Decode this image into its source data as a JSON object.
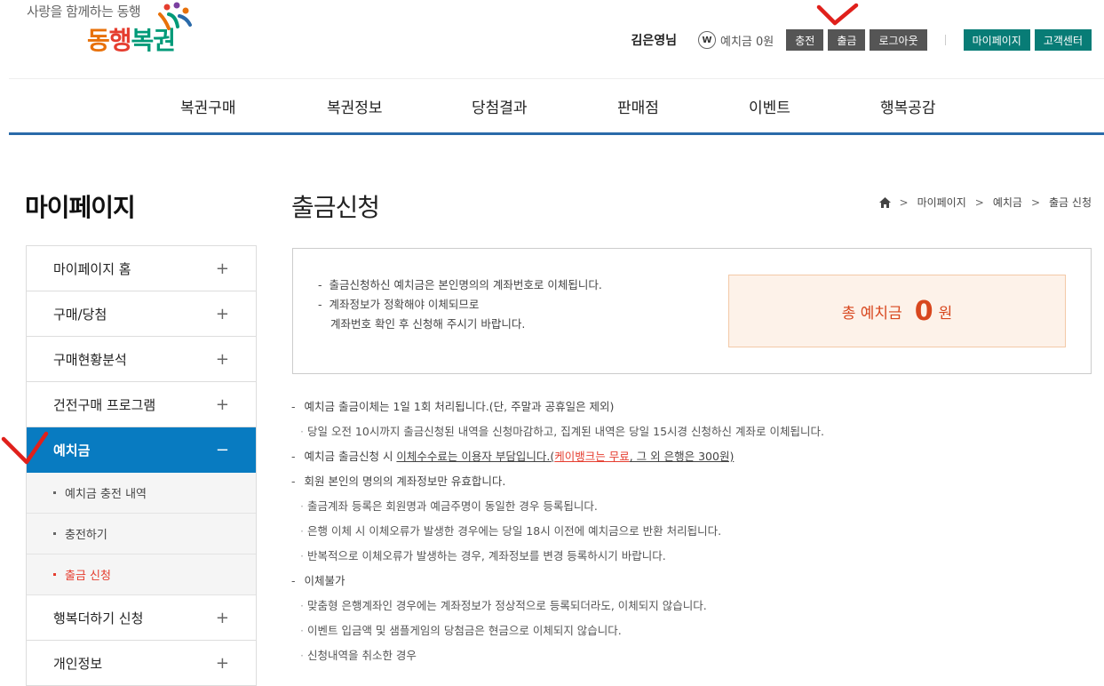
{
  "header": {
    "slogan": "사랑을 함께하는 동행",
    "brand_part1": "동",
    "brand_part2": "행",
    "brand_part3": "복권",
    "user_name": "김은영님",
    "w_badge": "W",
    "balance_text": "예치금 0원",
    "buttons": [
      "충전",
      "출금",
      "로그아웃"
    ],
    "right_buttons": [
      "마이페이지",
      "고객센터"
    ]
  },
  "gnb": [
    "복권구매",
    "복권정보",
    "당첨결과",
    "판매점",
    "이벤트",
    "행복공감"
  ],
  "sidebar": {
    "title": "마이페이지",
    "items": [
      {
        "label": "마이페이지 홈",
        "sign": "+"
      },
      {
        "label": "구매/당첨",
        "sign": "+"
      },
      {
        "label": "구매현황분석",
        "sign": "+"
      },
      {
        "label": "건전구매 프로그램",
        "sign": "+"
      },
      {
        "label": "예치금",
        "sign": "−"
      }
    ],
    "subitems": [
      "예치금 충전 내역",
      "충전하기",
      "출금 신청"
    ],
    "items_after": [
      {
        "label": "행복더하기 신청",
        "sign": "+"
      },
      {
        "label": "개인정보",
        "sign": "+"
      }
    ]
  },
  "main": {
    "title": "출금신청",
    "breadcrumb": [
      "마이페이지",
      "예치금",
      "출금 신청"
    ],
    "info": {
      "line1": "출금신청하신 예치금은 본인명의의 계좌번호로 이체됩니다.",
      "line2": "계좌정보가 정확해야 이체되므로",
      "line3": "계좌번호 확인 후 신청해 주시기 바랍니다."
    },
    "total": {
      "label": "총 예치금",
      "amount": "0",
      "unit": "원"
    },
    "notes": {
      "n1": "예치금 출금이체는 1일 1회 처리됩니다.(단, 주말과 공휴일은 제외)",
      "n1a": "당일 오전 10시까지 출금신청된 내역을 신청마감하고, 집계된 내역은 당일 15시경 신청하신 계좌로 이체됩니다.",
      "n2_pre": "예치금 출금신청 시 ",
      "n2_u": "이체수수료는 이용자 부담입니다.",
      "n2_paren_open": "(",
      "n2_red": "케이뱅크는 무료",
      "n2_rest": ", 그 외 은행은 300원)",
      "n3": "회원 본인의 명의의 계좌정보만 유효합니다.",
      "n3a": "출금계좌 등록은 회원명과 예금주명이 동일한 경우 등록됩니다.",
      "n3b": "은행 이체 시 이체오류가 발생한 경우에는 당일 18시 이전에 예치금으로 반환 처리됩니다.",
      "n3c": "반복적으로 이체오류가 발생하는 경우, 계좌정보를 변경 등록하시기 바랍니다.",
      "n4": "이체불가",
      "n4a": "맞춤형 은행계좌인 경우에는 계좌정보가 정상적으로 등록되더라도, 이체되지 않습니다.",
      "n4b": "이벤트 입금액 및 샘플게임의 당첨금은 현금으로 이체되지 않습니다.",
      "n4c": "신청내역을 취소한 경우"
    }
  },
  "colors": {
    "accent_blue": "#087bc1",
    "teal": "#087c76",
    "red": "#e53d2f",
    "check_red": "#e0201b"
  }
}
